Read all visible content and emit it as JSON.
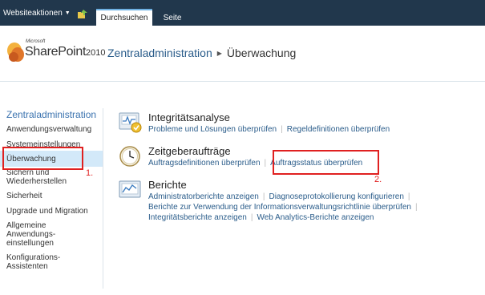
{
  "ribbon": {
    "site_actions": "Websiteaktionen",
    "tabs": [
      {
        "label": "Durchsuchen"
      },
      {
        "label": "Seite"
      }
    ]
  },
  "header": {
    "logo_microsoft": "Microsoft",
    "logo_product": "SharePoint",
    "logo_version": "2010",
    "breadcrumb_root": "Zentraladministration",
    "breadcrumb_current": "Überwachung"
  },
  "leftnav": {
    "title": "Zentraladministration",
    "items": [
      {
        "label": "Anwendungsverwaltung"
      },
      {
        "label": "Systemeinstellungen"
      },
      {
        "label": "Überwachung"
      },
      {
        "label": "Sichern und Wiederherstellen"
      },
      {
        "label": "Sicherheit"
      },
      {
        "label": "Upgrade und Migration"
      },
      {
        "label": "Allgemeine Anwendungs-einstellungen"
      },
      {
        "label": "Konfigurations-Assistenten"
      }
    ]
  },
  "sections": [
    {
      "title": "Integritätsanalyse",
      "icon": "health-analyzer-icon",
      "links": [
        "Probleme und Lösungen überprüfen",
        "Regeldefinitionen überprüfen"
      ]
    },
    {
      "title": "Zeitgeberaufträge",
      "icon": "clock-icon",
      "links": [
        "Auftragsdefinitionen überprüfen",
        "Auftragsstatus überprüfen"
      ]
    },
    {
      "title": "Berichte",
      "icon": "reports-icon",
      "links": [
        "Administratorberichte anzeigen",
        "Diagnoseprotokollierung konfigurieren",
        "Berichte zur Verwendung der Informationsverwaltungsrichtlinie überprüfen",
        "Integritätsberichte anzeigen",
        "Web Analytics-Berichte anzeigen"
      ]
    }
  ],
  "annotations": {
    "step1": "1.",
    "step2": "2."
  },
  "colors": {
    "ribbon": "#21374c",
    "link": "#2a5c8a",
    "nav_title": "#3b73af",
    "annotation": "#e02020",
    "selected": "#d3e9f9"
  }
}
